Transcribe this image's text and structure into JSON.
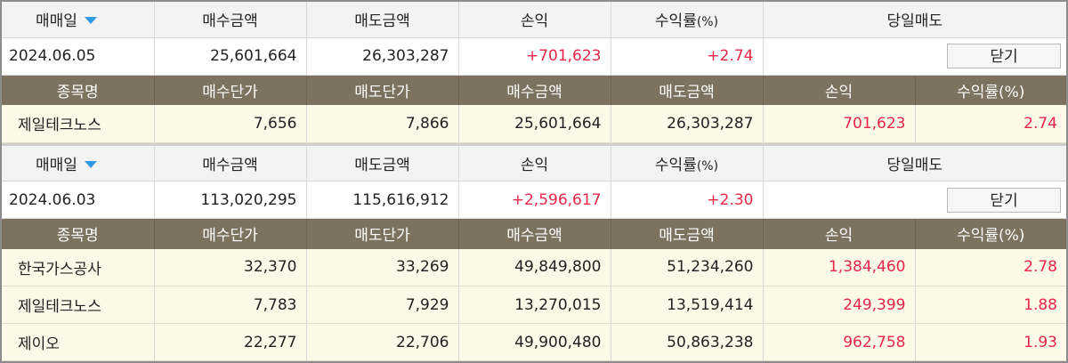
{
  "colors": {
    "profit": "#e8264a",
    "header_bar": "#7d7160",
    "sort_arrow": "#2f9be6",
    "row_bg": "#fdf9e8"
  },
  "icons": {
    "sort": "sort-down-triangle-icon"
  },
  "blocks": [
    {
      "header": {
        "date_label": "매매일",
        "buy_amount": "매수금액",
        "sell_amount": "매도금액",
        "profit": "손익",
        "rate_label": "수익률",
        "rate_unit": "(%)",
        "day_sell": "당일매도"
      },
      "summary": {
        "date": "2024.06.05",
        "buy_amount": "25,601,664",
        "sell_amount": "26,303,287",
        "profit": "+701,623",
        "rate": "+2.74",
        "close_label": "닫기"
      },
      "columns": {
        "name": "종목명",
        "buy_price": "매수단가",
        "sell_price": "매도단가",
        "buy_amount": "매수금액",
        "sell_amount": "매도금액",
        "profit": "손익",
        "rate": "수익률(%)"
      },
      "rows": [
        {
          "name": "제일테크노스",
          "buy_price": "7,656",
          "sell_price": "7,866",
          "buy_amount": "25,601,664",
          "sell_amount": "26,303,287",
          "profit": "701,623",
          "rate": "2.74"
        }
      ]
    },
    {
      "header": {
        "date_label": "매매일",
        "buy_amount": "매수금액",
        "sell_amount": "매도금액",
        "profit": "손익",
        "rate_label": "수익률",
        "rate_unit": "(%)",
        "day_sell": "당일매도"
      },
      "summary": {
        "date": "2024.06.03",
        "buy_amount": "113,020,295",
        "sell_amount": "115,616,912",
        "profit": "+2,596,617",
        "rate": "+2.30",
        "close_label": "닫기"
      },
      "columns": {
        "name": "종목명",
        "buy_price": "매수단가",
        "sell_price": "매도단가",
        "buy_amount": "매수금액",
        "sell_amount": "매도금액",
        "profit": "손익",
        "rate": "수익률(%)"
      },
      "rows": [
        {
          "name": "한국가스공사",
          "buy_price": "32,370",
          "sell_price": "33,269",
          "buy_amount": "49,849,800",
          "sell_amount": "51,234,260",
          "profit": "1,384,460",
          "rate": "2.78"
        },
        {
          "name": "제일테크노스",
          "buy_price": "7,783",
          "sell_price": "7,929",
          "buy_amount": "13,270,015",
          "sell_amount": "13,519,414",
          "profit": "249,399",
          "rate": "1.88"
        },
        {
          "name": "제이오",
          "buy_price": "22,277",
          "sell_price": "22,706",
          "buy_amount": "49,900,480",
          "sell_amount": "50,863,238",
          "profit": "962,758",
          "rate": "1.93"
        }
      ]
    }
  ]
}
